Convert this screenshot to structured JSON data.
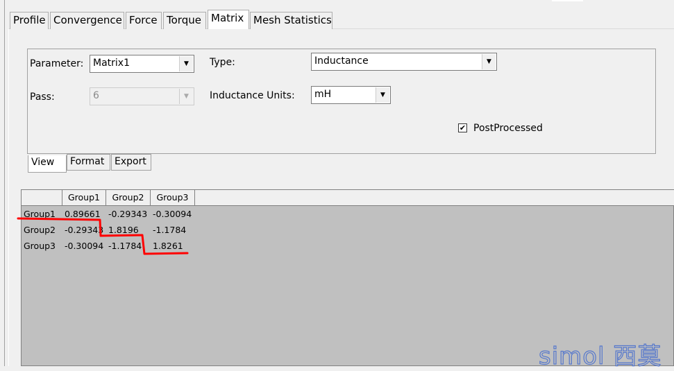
{
  "tabs": [
    "Profile",
    "Convergence",
    "Force",
    "Torque",
    "Matrix",
    "Mesh Statistics"
  ],
  "active_tab": "Matrix",
  "parameter": {
    "label": "Parameter:",
    "value": "Matrix1"
  },
  "pass": {
    "label": "Pass:",
    "value": "6"
  },
  "type": {
    "label": "Type:",
    "value": "Inductance"
  },
  "units": {
    "label": "Inductance Units:",
    "value": "mH"
  },
  "postprocessed": {
    "label": "PostProcessed",
    "checked": true
  },
  "subtabs": [
    "View",
    "Format",
    "Export"
  ],
  "grid": {
    "columns": [
      "Group1",
      "Group2",
      "Group3"
    ],
    "rows": [
      {
        "name": "Group1",
        "values": [
          "0.89661",
          "-0.29343",
          "-0.30094"
        ]
      },
      {
        "name": "Group2",
        "values": [
          "-0.29343",
          "1.8196",
          "-1.1784"
        ]
      },
      {
        "name": "Group3",
        "values": [
          "-0.30094",
          "-1.1784",
          "1.8261"
        ]
      }
    ]
  },
  "annotation_color": "#ff0000",
  "watermark": "simol 西莫"
}
